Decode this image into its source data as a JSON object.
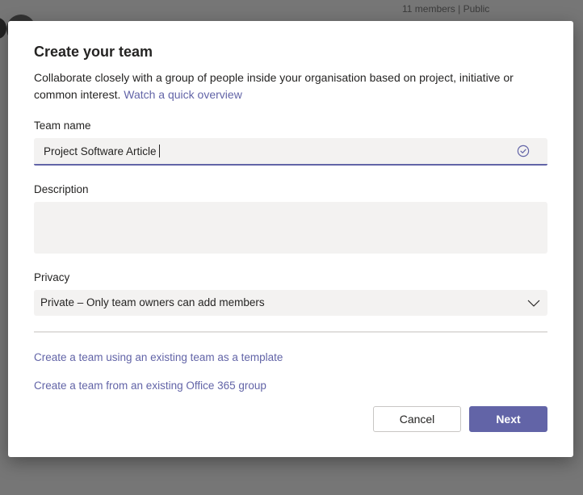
{
  "background": {
    "members_text": "11 members | Public"
  },
  "dialog": {
    "title": "Create your team",
    "intro_text": "Collaborate closely with a group of people inside your organisation based on project, initiative or common interest.",
    "intro_link": "Watch a quick overview",
    "team_name": {
      "label": "Team name",
      "value": "Project Software Article",
      "status_icon": "check-circle-icon"
    },
    "description": {
      "label": "Description",
      "value": "",
      "placeholder": ""
    },
    "privacy": {
      "label": "Privacy",
      "selected": "Private – Only team owners can add members",
      "dropdown_icon": "chevron-down-icon"
    },
    "options": [
      {
        "label": "Create a team using an existing team as a template"
      },
      {
        "label": "Create a team from an existing Office 365 group"
      }
    ],
    "buttons": {
      "cancel": "Cancel",
      "next": "Next"
    }
  },
  "colors": {
    "accent": "#6264a7",
    "input_background": "#f3f2f1",
    "text": "#252423",
    "overlay": "#767676"
  }
}
